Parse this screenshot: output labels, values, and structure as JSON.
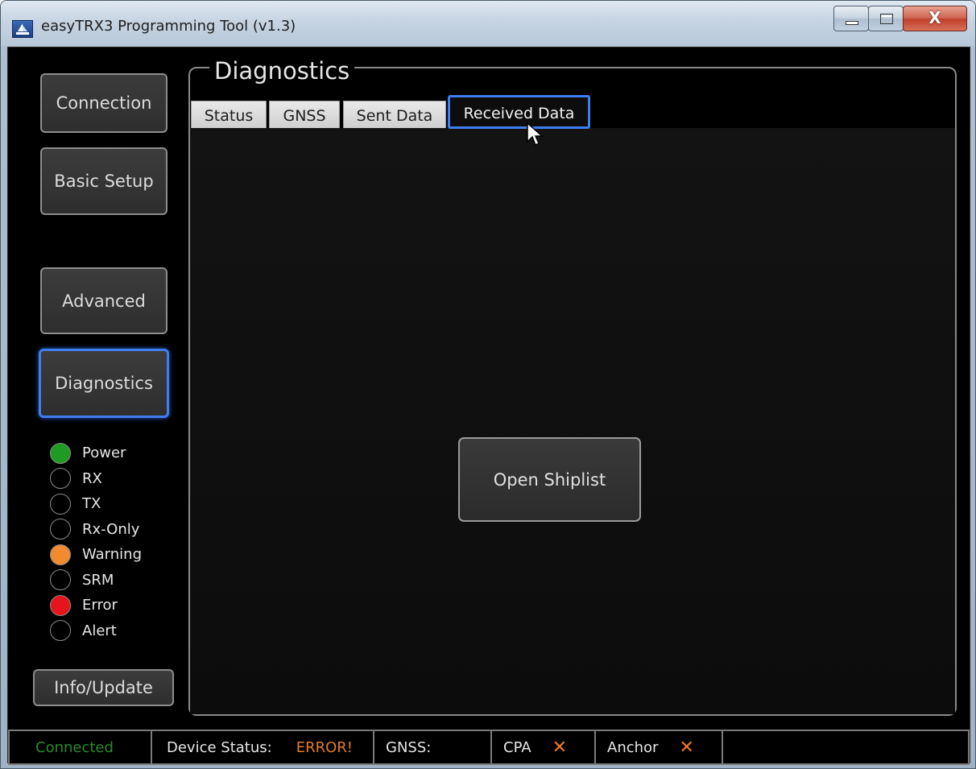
{
  "window": {
    "title": "easyTRX3 Programming Tool (v1.3)",
    "controls": {
      "minimize": "minimize",
      "maximize": "maximize",
      "close": "X"
    }
  },
  "nav": {
    "connection": "Connection",
    "basic_setup": "Basic Setup",
    "advanced": "Advanced",
    "diagnostics": "Diagnostics",
    "info_update": "Info/Update",
    "active": "diagnostics"
  },
  "leds": [
    {
      "label": "Power",
      "color": "#1f9a22"
    },
    {
      "label": "RX",
      "color": "#000000"
    },
    {
      "label": "TX",
      "color": "#000000"
    },
    {
      "label": "Rx-Only",
      "color": "#000000"
    },
    {
      "label": "Warning",
      "color": "#f28a30"
    },
    {
      "label": "SRM",
      "color": "#000000"
    },
    {
      "label": "Error",
      "color": "#e8141c"
    },
    {
      "label": "Alert",
      "color": "#000000"
    }
  ],
  "diagnostics": {
    "title": "Diagnostics",
    "tabs": [
      "Status",
      "GNSS",
      "Sent Data",
      "Received Data"
    ],
    "active_tab": "Received Data",
    "open_shiplist": "Open Shiplist"
  },
  "statusbar": {
    "connected": "Connected",
    "connected_color": "#2a8a2a",
    "device_status_label": "Device Status:",
    "device_status_value": "ERROR!",
    "error_color": "#e07a2a",
    "gnss_label": "GNSS:",
    "cpa_label": "CPA",
    "anchor_label": "Anchor",
    "x_glyph": "✕",
    "x_color": "#f47a20"
  }
}
